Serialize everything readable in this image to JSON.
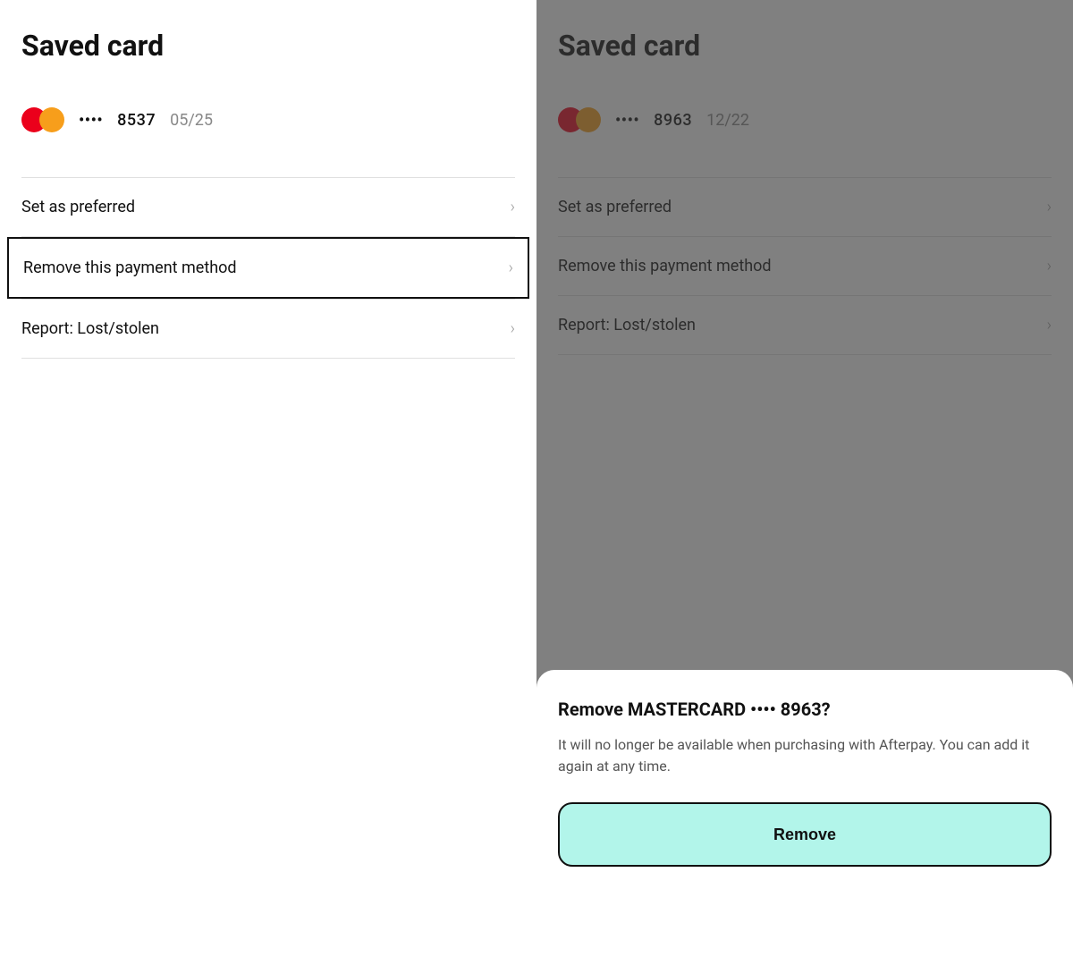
{
  "left_panel": {
    "title": "Saved card",
    "card": {
      "dots": "••••",
      "last4": "8537",
      "expiry": "05/25"
    },
    "menu_items": [
      {
        "id": "set-preferred",
        "label": "Set as preferred",
        "selected": false
      },
      {
        "id": "remove-payment",
        "label": "Remove this payment method",
        "selected": true
      },
      {
        "id": "report-stolen",
        "label": "Report: Lost/stolen",
        "selected": false
      }
    ]
  },
  "right_panel": {
    "title": "Saved card",
    "card": {
      "dots": "••••",
      "last4": "8963",
      "expiry": "12/22"
    },
    "menu_items": [
      {
        "id": "set-preferred",
        "label": "Set as preferred",
        "selected": false
      },
      {
        "id": "remove-payment",
        "label": "Remove this payment method",
        "selected": false
      },
      {
        "id": "report-stolen",
        "label": "Report: Lost/stolen",
        "selected": false
      }
    ],
    "bottom_sheet": {
      "title": "Remove MASTERCARD •••• 8963?",
      "description": "It will no longer be available when purchasing with Afterpay. You can add it again at any time.",
      "remove_button_label": "Remove"
    }
  },
  "icons": {
    "chevron": "›"
  }
}
